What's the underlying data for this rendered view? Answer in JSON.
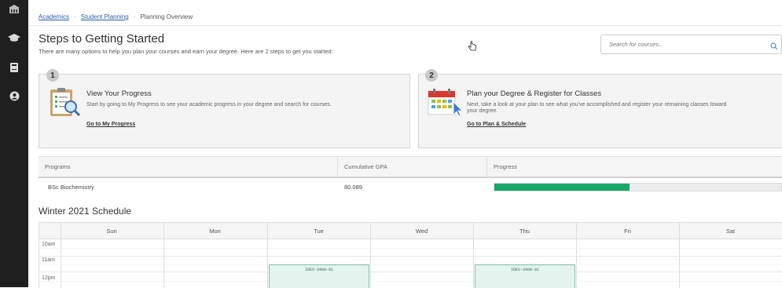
{
  "sidebar": {
    "icons": [
      "building-icon",
      "graduation-cap-icon",
      "book-icon",
      "user-circle-icon"
    ]
  },
  "breadcrumb": {
    "items": [
      "Academics",
      "Student Planning",
      "Planning Overview"
    ]
  },
  "header": {
    "title": "Steps to Getting Started",
    "subtitle": "There are many options to help you plan your courses and earn your degree. Here are 2 steps to get you started:"
  },
  "search": {
    "placeholder": "Search for courses..."
  },
  "steps": [
    {
      "number": "1",
      "title": "View Your Progress",
      "text": "Start by going to My Progress to see your academic progress in your degree and search for courses.",
      "link": "Go to My Progress"
    },
    {
      "number": "2",
      "title": "Plan your Degree & Register for Classes",
      "text": "Next, take a look at your plan to see what you've accomplished and register your remaining classes toward your degree.",
      "link": "Go to Plan & Schedule"
    }
  ],
  "programs_table": {
    "headers": [
      "Programs",
      "Cumulative GPA",
      "Progress"
    ],
    "rows": [
      {
        "program": "BSc Biochemistry",
        "gpa": "80.089",
        "progress": 0.47
      }
    ]
  },
  "schedule": {
    "title": "Winter 2021 Schedule",
    "days": [
      "Sun",
      "Mon",
      "Tue",
      "Wed",
      "Thu",
      "Fri",
      "Sat"
    ],
    "times": [
      "10am",
      "11am",
      "12pm"
    ],
    "events": [
      {
        "day": "Tue",
        "label": "IDEV-3400-01"
      },
      {
        "day": "Thu",
        "label": "IDEV-3400-01"
      }
    ]
  },
  "colors": {
    "sidebar": "#1f1f1f",
    "link": "#2b5fa6",
    "progress": "#18a86a",
    "event_bg": "#e4f3ee"
  }
}
